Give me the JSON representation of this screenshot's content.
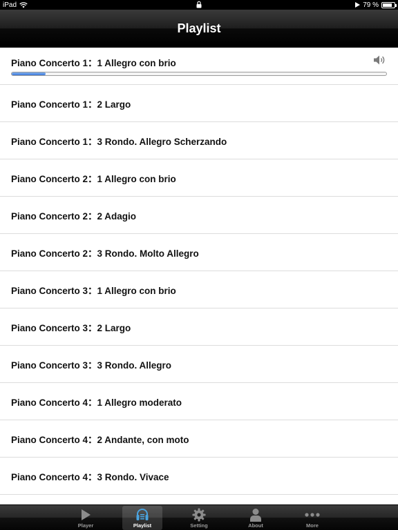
{
  "status": {
    "device": "iPad",
    "battery": "79 %",
    "battery_level": 0.79
  },
  "nav": {
    "title": "Playlist"
  },
  "playlist": {
    "current_index": 0,
    "current_progress": 0.09,
    "items": [
      {
        "label": "Piano Concerto 1：1 Allegro con brio"
      },
      {
        "label": "Piano Concerto 1：2 Largo"
      },
      {
        "label": "Piano Concerto 1：3 Rondo. Allegro Scherzando"
      },
      {
        "label": "Piano Concerto 2：1 Allegro con brio"
      },
      {
        "label": "Piano Concerto 2：2 Adagio"
      },
      {
        "label": "Piano Concerto 2：3 Rondo. Molto Allegro"
      },
      {
        "label": "Piano Concerto 3：1 Allegro con brio"
      },
      {
        "label": "Piano Concerto 3：2 Largo"
      },
      {
        "label": "Piano Concerto 3：3 Rondo. Allegro"
      },
      {
        "label": "Piano Concerto 4：1 Allegro moderato"
      },
      {
        "label": "Piano Concerto 4：2 Andante, con moto"
      },
      {
        "label": "Piano Concerto 4：3 Rondo. Vivace"
      }
    ]
  },
  "tabs": {
    "active": "playlist",
    "player": {
      "label": "Player",
      "icon": "play-icon"
    },
    "playlist": {
      "label": "Playlist",
      "icon": "playlist-icon"
    },
    "setting": {
      "label": "Setting",
      "icon": "gear-icon"
    },
    "about": {
      "label": "About",
      "icon": "person-icon"
    },
    "more": {
      "label": "More",
      "icon": "more-dots-icon"
    }
  },
  "colors": {
    "accent": "#3d78d8",
    "tab_active_icon": "#4aa3df",
    "tab_inactive_icon": "#8c8c8c"
  }
}
